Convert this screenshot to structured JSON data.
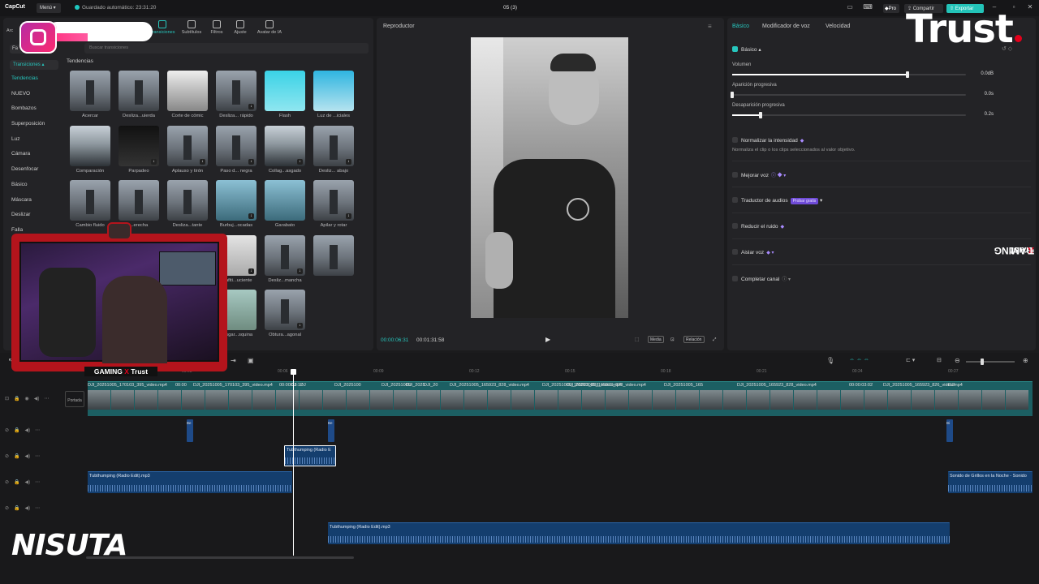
{
  "app": {
    "name": "CapCut",
    "menu": "Menú",
    "autosave": "Guardado automático: 23:31:20",
    "project_title": "05 (3)"
  },
  "header": {
    "pro": "Pro",
    "share": "Compartir",
    "export": "Exportar"
  },
  "left_panel": {
    "tools": [
      "Transiciones",
      "Subtítulos",
      "Filtros",
      "Ajuste",
      "Avatar de IA"
    ],
    "import_label": "Arc",
    "search_placeholder": "Buscar transiciones",
    "favorites": "Fa",
    "category_button": "Transiciones",
    "section_title": "Tendencias",
    "categories": [
      "Tendencias",
      "NUEVO",
      "Bombazos",
      "Superposición",
      "Luz",
      "Cámara",
      "Desenfocar",
      "Básico",
      "Máscara",
      "Deslizar",
      "Falla"
    ],
    "thumbnails": [
      {
        "label": "Acercar",
        "style": "tower",
        "dl": false
      },
      {
        "label": "Desliza...uierda",
        "style": "tower",
        "dl": false
      },
      {
        "label": "Corte de cómic",
        "style": "bw",
        "dl": false
      },
      {
        "label": "Desliza... rápido",
        "style": "tower",
        "dl": true
      },
      {
        "label": "Flash",
        "style": "face1",
        "dl": false
      },
      {
        "label": "Luz de ...iciales",
        "style": "face2",
        "dl": false
      },
      {
        "label": "Comparación",
        "style": "snow",
        "dl": false
      },
      {
        "label": "Parpadeo",
        "style": "dark",
        "dl": true
      },
      {
        "label": "Aplauso y tirón",
        "style": "tower",
        "dl": true
      },
      {
        "label": "Paso d... negra",
        "style": "tower",
        "dl": true
      },
      {
        "label": "Collag...asgado",
        "style": "snow",
        "dl": true
      },
      {
        "label": "Desliz... abajo",
        "style": "tower",
        "dl": true
      },
      {
        "label": "Cambio fluido",
        "style": "tower",
        "dl": false
      },
      {
        "label": "...erecha",
        "style": "tower",
        "dl": false
      },
      {
        "label": "Desliza...tante",
        "style": "tower",
        "dl": false
      },
      {
        "label": "Burbuj...ocadas",
        "style": "blue",
        "dl": true
      },
      {
        "label": "Garabato",
        "style": "blue",
        "dl": false
      },
      {
        "label": "Apilar y rotar",
        "style": "tower",
        "dl": true
      },
      {
        "label": "",
        "style": "tower",
        "dl": false
      },
      {
        "label": "",
        "style": "tower",
        "dl": false
      },
      {
        "label": "...e cubo",
        "style": "dark",
        "dl": false
      },
      {
        "label": "Grafiti...uciente",
        "style": "girl",
        "dl": true
      },
      {
        "label": "Desliz...mancha",
        "style": "tower",
        "dl": true
      },
      {
        "label": "",
        "style": "tower",
        "dl": false
      },
      {
        "label": "",
        "style": "tower",
        "dl": false
      },
      {
        "label": "",
        "style": "tower",
        "dl": false
      },
      {
        "label": "...n d... de sol",
        "style": "girl",
        "dl": false
      },
      {
        "label": "Desgar...squina",
        "style": "green",
        "dl": false
      },
      {
        "label": "Obtura...agonal",
        "style": "tower",
        "dl": true
      }
    ]
  },
  "player": {
    "title": "Reproductor",
    "time_current": "00:00:06:31",
    "time_total": "00:01:31:58",
    "media": "Media",
    "ratio": "Relación"
  },
  "right_panel": {
    "tabs": [
      "Básico",
      "Modificador de voz",
      "Velocidad"
    ],
    "section": "Básico",
    "volume": {
      "label": "Volumen",
      "value": "0.0dB",
      "level": 0.75
    },
    "fade_in": {
      "label": "Aparición progresiva",
      "value": "0.0s",
      "level": 0.0
    },
    "fade_out": {
      "label": "Desaparición progresiva",
      "value": "0.2s",
      "level": 0.12
    },
    "normalize": {
      "label": "Normalizar la intensidad",
      "desc": "Normaliza el clip o los clips seleccionados al valor objetivo."
    },
    "options": [
      "Mejorar voz",
      "Traductor de audios",
      "Reducir el ruido",
      "Aislar voz",
      "Completar canal"
    ],
    "trial_badge": "Probar gratis"
  },
  "timeline": {
    "cover_label": "Portada",
    "ruler": [
      "00:00",
      "00:03",
      "00:06",
      "00:09",
      "00:12",
      "00:15",
      "00:18",
      "00:21",
      "00:24",
      "00:27"
    ],
    "video_clips": [
      "DJI_20251005_170103_395_video.mp4",
      "00:00",
      "DJI_20251005_170103_395_video.mp4",
      "00:00:03:12",
      "DJ",
      "DJ",
      "DJI_2025100",
      "DJI_20251005",
      "DJI_2025",
      "DJI_20",
      "DJI_20251005_165923_828_video.mp4",
      "DJI_20251005_165923_828_video.mp4",
      "DJI_20251005_165923_828_video.mp4",
      "DJI_20251005_165",
      "DJI_20251005_165923_828_video.mp4",
      "00:00:03:02",
      "DJI_20251005_165923_826_video.mp4",
      "DJI"
    ],
    "sfx_labels": [
      "Be",
      "Be",
      "Bi"
    ],
    "audio_selected": "Tubthumping (Radio E",
    "audio1": "Tubthumping (Radio Edit).mp3",
    "audio2": "Tubthumping (Radio Edit).mp3",
    "audio3": "Sonido de Grillos en la Noche - Sonido"
  },
  "overlays": {
    "brand": "Trust",
    "gaming": "GAMING",
    "gaming_x": "X",
    "gaming_trust": "Trust",
    "webcam_label_a": "GAMING",
    "webcam_label_x": "X",
    "webcam_label_b": "Trust",
    "nisuta": "NISUTA"
  },
  "colors": {
    "accent": "#27c6bd",
    "export": "#23c3b8",
    "trust_red": "#e3001b",
    "audio_clip": "#143e6e",
    "video_clip": "#1c5f63"
  }
}
